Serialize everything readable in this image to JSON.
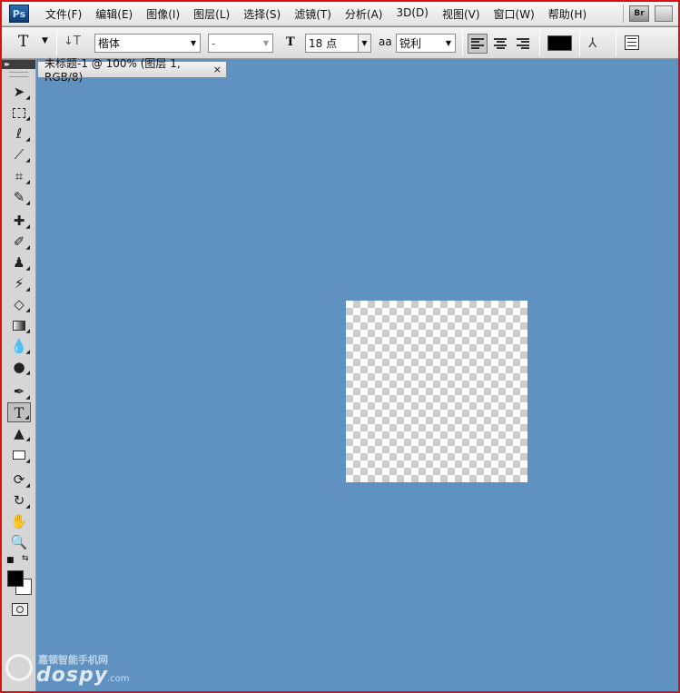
{
  "app": {
    "logo": "Ps",
    "bridge_button": "Br"
  },
  "menu": [
    "文件(F)",
    "编辑(E)",
    "图像(I)",
    "图层(L)",
    "选择(S)",
    "滤镜(T)",
    "分析(A)",
    "3D(D)",
    "视图(V)",
    "窗口(W)",
    "帮助(H)"
  ],
  "options": {
    "tool_glyph": "T",
    "font_family": "楷体",
    "font_style": "-",
    "font_size": "18 点",
    "size_icon": "T",
    "antialias_icon": "aa",
    "antialias": "锐利",
    "text_color": "#000000",
    "align_active": "left"
  },
  "document": {
    "tab_title": "未标题-1 @ 100% (图层 1, RGB/8)",
    "close_glyph": "×",
    "canvas_transparent": true
  },
  "toolbar": {
    "tools": [
      "move-icon",
      "marquee-icon",
      "lasso-icon",
      "magic-wand-icon",
      "crop-icon",
      "eyedropper-icon",
      "healing-brush-icon",
      "brush-icon",
      "clone-stamp-icon",
      "history-brush-icon",
      "eraser-icon",
      "gradient-icon",
      "blur-icon",
      "dodge-icon",
      "pen-icon",
      "type-icon",
      "path-selection-icon",
      "rectangle-icon",
      "3d-rotate-icon",
      "3d-orbit-icon",
      "hand-icon",
      "zoom-icon"
    ],
    "active_tool": "type-icon",
    "foreground_color": "#000000",
    "background_color": "#ffffff"
  },
  "colors": {
    "workspace": "#5f91c1",
    "frame": "#dd1111"
  },
  "watermark": {
    "top": "嘉顿智能手机网",
    "main": "dospy",
    "suffix": ".com"
  }
}
